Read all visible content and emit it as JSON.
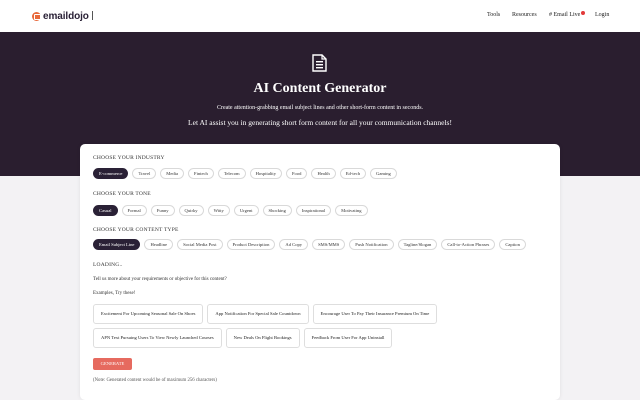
{
  "nav": {
    "logo_text": "emaildojo",
    "links": [
      "Tools",
      "Resources",
      "# Email Live",
      "Login"
    ]
  },
  "hero": {
    "icon": "document-lines-icon",
    "title": "AI Content Generator",
    "subtitle": "Create attention-grabbing email subject lines and other short-form content in seconds.",
    "tagline": "Let AI assist you in generating short form content for all your communication channels!"
  },
  "industry": {
    "label": "CHOOSE YOUR INDUSTRY",
    "options": [
      "E-commerce",
      "Travel",
      "Media",
      "Fintech",
      "Telecom",
      "Hospitality",
      "Food",
      "Health",
      "Ed-tech",
      "Gaming"
    ],
    "selected": "E-commerce"
  },
  "tone": {
    "label": "CHOOSE YOUR TONE",
    "options": [
      "Casual",
      "Formal",
      "Funny",
      "Quirky",
      "Witty",
      "Urgent",
      "Shocking",
      "Inspirational",
      "Motivating"
    ],
    "selected": "Casual"
  },
  "content_type": {
    "label": "CHOOSE YOUR CONTENT TYPE",
    "options": [
      "Email Subject Line",
      "Headline",
      "Social Media Post",
      "Product Description",
      "Ad Copy",
      "SMS/MMS",
      "Push Notification",
      "Tagline/Slogan",
      "Call-to-Action Phrases",
      "Caption"
    ],
    "selected": "Email Subject Line"
  },
  "loading_text": "LOADING..",
  "prompt_question": "Tell us more about your requirements or objective for this content?",
  "examples_label": "Examples, Try these!",
  "examples": [
    [
      "Excitement For Upcoming Seasonal Sale On Shoes",
      "App Notification For Special Sale Countdown",
      "Encourage User To Pay Their Insurance Premium On Time"
    ],
    [
      "APN Text Pursuing Users To View Newly Launched Courses",
      "New Deals On Flight Bookings",
      "Feedback From User For App Uninstall"
    ]
  ],
  "generate_label": "GENERATE",
  "note": "(Note: Generated content would be of maximum 256 characters)",
  "colors": {
    "hero_bg": "#2a1e2f",
    "chip_active": "#2a2136",
    "generate_button": "#e66a5f",
    "logo_accent": "#e8683a",
    "live_dot": "#e23a3a"
  }
}
